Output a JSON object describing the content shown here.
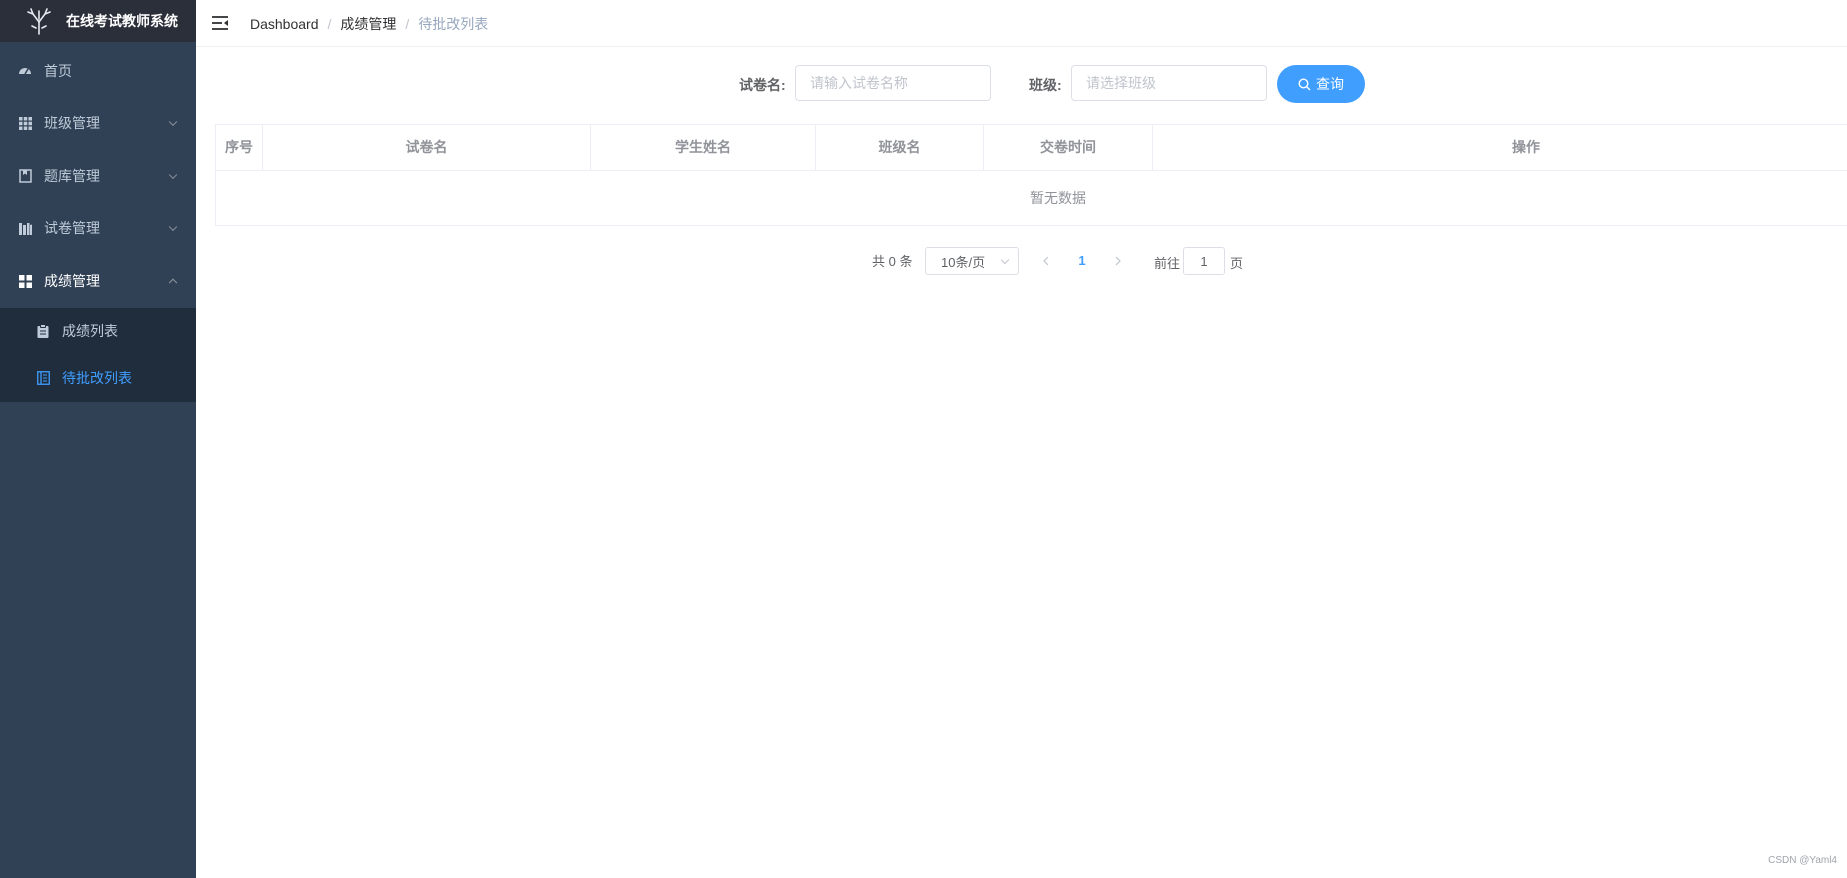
{
  "app": {
    "title": "在线考试教师系统"
  },
  "sidebar": {
    "items": [
      {
        "label": "首页",
        "icon": "dashboard-icon"
      },
      {
        "label": "班级管理",
        "icon": "grid-icon"
      },
      {
        "label": "题库管理",
        "icon": "book-icon"
      },
      {
        "label": "试卷管理",
        "icon": "library-icon"
      },
      {
        "label": "成绩管理",
        "icon": "apps-icon"
      }
    ],
    "submenu": [
      {
        "label": "成绩列表",
        "icon": "clipboard-icon"
      },
      {
        "label": "待批改列表",
        "icon": "document-icon"
      }
    ]
  },
  "breadcrumb": [
    "Dashboard",
    "成绩管理",
    "待批改列表"
  ],
  "search": {
    "paper_label": "试卷名:",
    "paper_placeholder": "请输入试卷名称",
    "class_label": "班级:",
    "class_placeholder": "请选择班级",
    "query_button": "查询"
  },
  "table": {
    "columns": [
      "序号",
      "试卷名",
      "学生姓名",
      "班级名",
      "交卷时间",
      "操作"
    ],
    "empty_text": "暂无数据"
  },
  "pagination": {
    "total_text": "共 0 条",
    "page_size": "10条/页",
    "current_page": "1",
    "goto_label": "前往",
    "goto_value": "1",
    "page_unit": "页"
  },
  "watermark": "CSDN @Yaml4",
  "colors": {
    "sidebar_bg": "#304156",
    "accent": "#409eff",
    "submenu_bg": "#1f2d3d"
  }
}
